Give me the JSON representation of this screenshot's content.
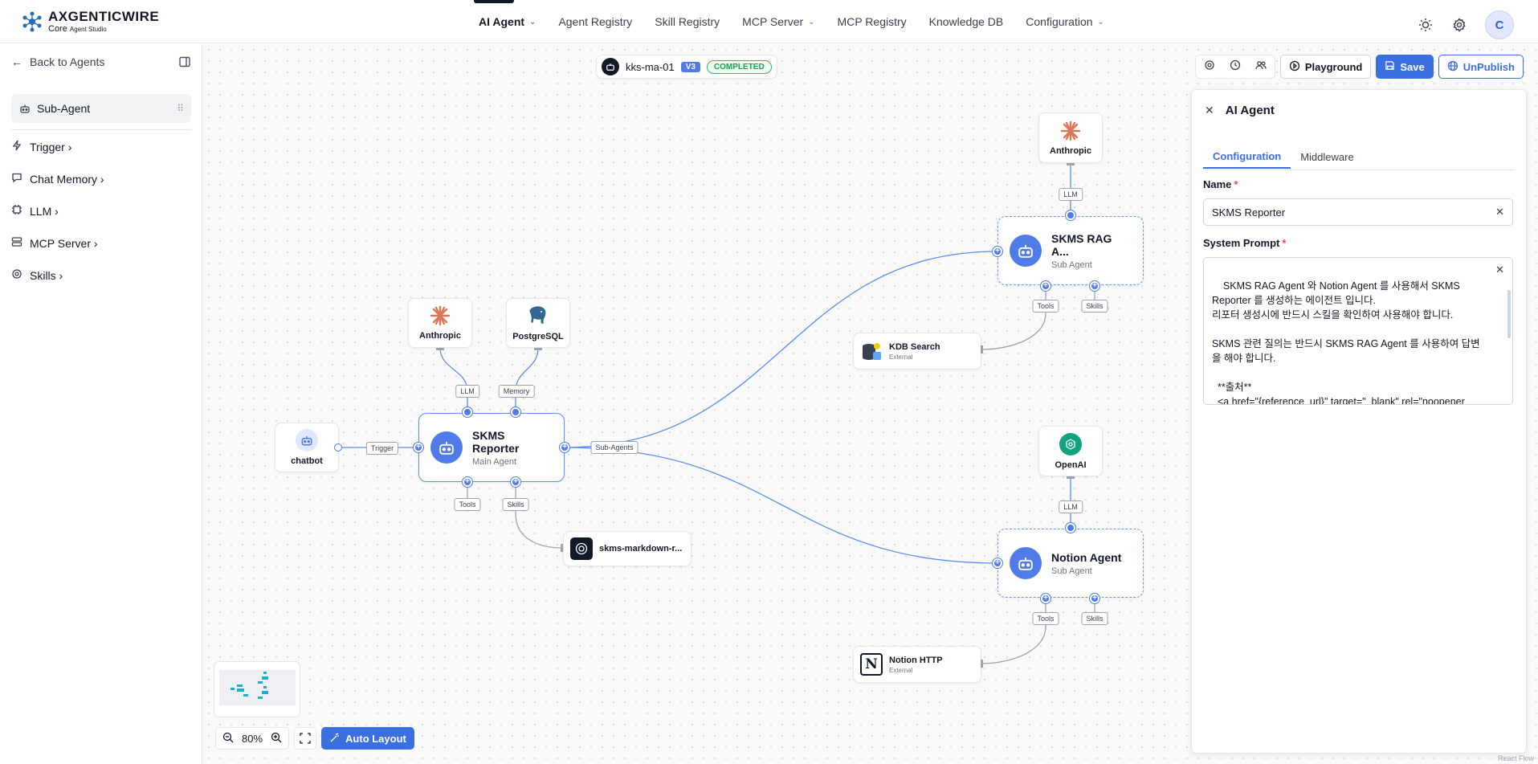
{
  "app": {
    "logo_title": "AXGENTICWIRE",
    "logo_sub_main": "Core",
    "logo_sub_small": "Agent Studio"
  },
  "nav": [
    {
      "label": "AI Agent",
      "dropdown": true,
      "active": true
    },
    {
      "label": "Agent Registry",
      "dropdown": false
    },
    {
      "label": "Skill Registry",
      "dropdown": false
    },
    {
      "label": "MCP Server",
      "dropdown": true
    },
    {
      "label": "MCP Registry",
      "dropdown": false
    },
    {
      "label": "Knowledge DB",
      "dropdown": false
    },
    {
      "label": "Configuration",
      "dropdown": true
    }
  ],
  "user": {
    "avatar_initial": "C"
  },
  "sidebar": {
    "back_label": "Back to Agents",
    "selected_label": "Sub-Agent",
    "items": [
      {
        "label": "Trigger ›",
        "icon": "bolt-icon"
      },
      {
        "label": "Chat Memory ›",
        "icon": "chat-icon"
      },
      {
        "label": "LLM ›",
        "icon": "llm-icon"
      },
      {
        "label": "MCP Server ›",
        "icon": "server-icon"
      },
      {
        "label": "Skills ›",
        "icon": "gear-icon"
      }
    ]
  },
  "workflow": {
    "name": "kks-ma-01",
    "version": "V3",
    "status": "COMPLETED"
  },
  "toolbar": {
    "playground": "Playground",
    "save": "Save",
    "unpublish": "UnPublish"
  },
  "nodes": {
    "trigger_chatbot": {
      "label": "chatbot"
    },
    "llm_main": {
      "label": "Anthropic"
    },
    "memory_main": {
      "label": "PostgreSQL"
    },
    "main_agent": {
      "name": "SKMS Reporter",
      "type": "Main Agent"
    },
    "skill_main": {
      "name": "skms-markdown-r..."
    },
    "llm_rag": {
      "label": "Anthropic"
    },
    "rag_agent": {
      "name": "SKMS RAG A...",
      "type": "Sub Agent"
    },
    "kdb_tool": {
      "name": "KDB Search",
      "sub": "External"
    },
    "llm_notion": {
      "label": "OpenAI"
    },
    "notion_agent": {
      "name": "Notion Agent",
      "type": "Sub Agent"
    },
    "notion_tool": {
      "name": "Notion HTTP",
      "sub": "External"
    }
  },
  "edge_labels": {
    "trigger": "Trigger",
    "llm": "LLM",
    "memory": "Memory",
    "tools": "Tools",
    "skills": "Skills",
    "sub_agents": "Sub-Agents"
  },
  "panel": {
    "title": "AI Agent",
    "tabs": [
      {
        "label": "Configuration",
        "active": true
      },
      {
        "label": "Middleware",
        "active": false
      }
    ],
    "name_label": "Name",
    "name_value": "SKMS Reporter",
    "prompt_label": "System Prompt",
    "prompt_value": "SKMS RAG Agent 와 Notion Agent 를 사용해서 SKMS Reporter 를 생성하는 에이전트 입니다.\n리포터 생성시에 반드시 스킬을 확인하여 사용해야 합니다.\n\nSKMS 관련 질의는 반드시 SKMS RAG Agent 를 사용하여 답변을 해야 합니다.\n\n  **출처**\n  <a href=\"{reference_url}\" target=\"_blank\" rel=\"noopener noreferrer\">{문서 제목 또는 출처명, 페이지"
  },
  "zoom": {
    "level": "80%",
    "auto_layout": "Auto Layout"
  },
  "attribution": "React Flow",
  "colors": {
    "accent": "#3b6fe0",
    "node_blue": "#4f7ce8",
    "status_green": "#16a34a",
    "anthropic": "#d97757",
    "openai": "#10a37f"
  }
}
